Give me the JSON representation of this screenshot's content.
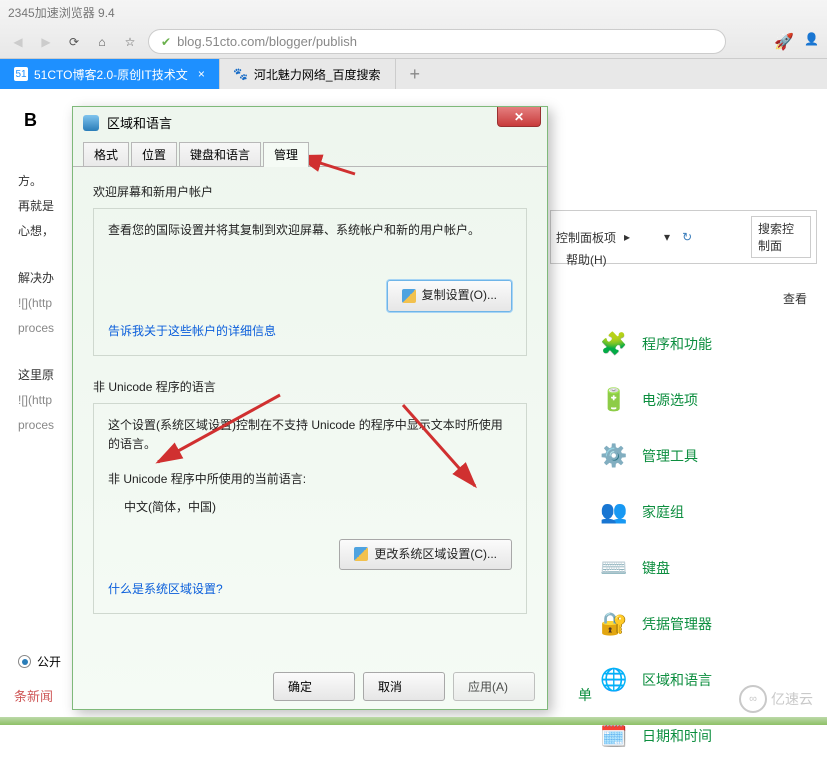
{
  "browser": {
    "title": "2345加速浏览器 9.4",
    "url": "blog.51cto.com/blogger/publish"
  },
  "tabs": [
    {
      "label": "51CTO博客2.0-原创IT技术文"
    },
    {
      "label": "河北魅力网络_百度搜索"
    }
  ],
  "bg": {
    "l1": "方。",
    "l2": "再就是",
    "l3": "心想，",
    "l4": "解决办",
    "l5": "![](http",
    "l6": "proces",
    "l7": "这里原",
    "l8": "![](http",
    "l9": "proces"
  },
  "cp": {
    "crumb1": "控制面板项",
    "search_ph": "搜索控制面",
    "help": "帮助(H)",
    "searchlink": "查看"
  },
  "sidebar": [
    {
      "icon": "🧩",
      "label": "程序和功能"
    },
    {
      "icon": "🔋",
      "label": "电源选项"
    },
    {
      "icon": "⚙️",
      "label": "管理工具"
    },
    {
      "icon": "👥",
      "label": "家庭组"
    },
    {
      "icon": "⌨️",
      "label": "键盘"
    },
    {
      "icon": "🔐",
      "label": "凭据管理器"
    },
    {
      "icon": "🌐",
      "label": "区域和语言"
    },
    {
      "icon": "🗓️",
      "label": "日期和时间"
    }
  ],
  "side_extra": "单",
  "dialog": {
    "title": "区域和语言",
    "tabs": {
      "t1": "格式",
      "t2": "位置",
      "t3": "键盘和语言",
      "t4": "管理"
    },
    "sec1_title": "欢迎屏幕和新用户帐户",
    "sec1_desc": "查看您的国际设置并将其复制到欢迎屏幕、系统帐户和新的用户帐户。",
    "copy_btn": "复制设置(O)...",
    "sec1_link": "告诉我关于这些帐户的详细信息",
    "sec2_title": "非 Unicode 程序的语言",
    "sec2_desc": "这个设置(系统区域设置)控制在不支持 Unicode 的程序中显示文本时所使用的语言。",
    "sec2_sub": "非 Unicode 程序中所使用的当前语言:",
    "sec2_lang": "中文(简体，中国)",
    "change_btn": "更改系统区域设置(C)...",
    "sec2_link": "什么是系统区域设置?",
    "ok": "确定",
    "cancel": "取消",
    "apply": "应用(A)"
  },
  "radio_label": "公开",
  "news": "条新闻",
  "watermark": "亿速云"
}
